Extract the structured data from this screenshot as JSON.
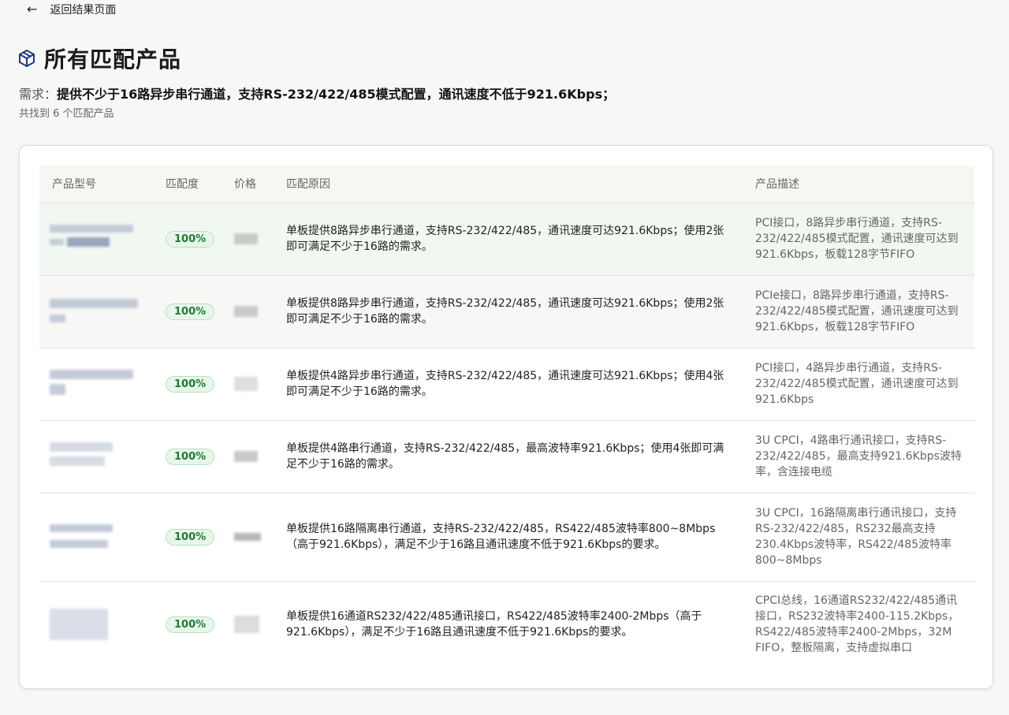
{
  "nav": {
    "back_label": "返回结果页面"
  },
  "header": {
    "title": "所有匹配产品",
    "requirement_prefix": "需求：",
    "requirement_text": "提供不少于16路异步串行通道，支持RS-232/422/485模式配置，通讯速度不低于921.6Kbps；",
    "count_text": "共找到 6 个匹配产品"
  },
  "table": {
    "columns": [
      "产品型号",
      "匹配度",
      "价格",
      "匹配原因",
      "产品描述"
    ],
    "rows": [
      {
        "match": "100%",
        "reason": "单板提供8路异步串行通道，支持RS-232/422/485，通讯速度可达921.6Kbps；使用2张即可满足不少于16路的需求。",
        "description": "PCI接口，8路异步串行通道，支持RS-232/422/485模式配置，通讯速度可达到921.6Kbps，板载128字节FIFO"
      },
      {
        "match": "100%",
        "reason": "单板提供8路异步串行通道，支持RS-232/422/485，通讯速度可达921.6Kbps；使用2张即可满足不少于16路的需求。",
        "description": "PCIe接口，8路异步串行通道，支持RS-232/422/485模式配置，通讯速度可达到921.6Kbps，板载128字节FIFO"
      },
      {
        "match": "100%",
        "reason": "单板提供4路异步串行通道，支持RS-232/422/485，通讯速度可达921.6Kbps；使用4张即可满足不少于16路的需求。",
        "description": "PCI接口，4路异步串行通道，支持RS-232/422/485模式配置，通讯速度可达到921.6Kbps"
      },
      {
        "match": "100%",
        "reason": "单板提供4路串行通道，支持RS-232/422/485，最高波特率921.6Kbps；使用4张即可满足不少于16路的需求。",
        "description": "3U CPCI，4路串行通讯接口，支持RS-232/422/485，最高支持921.6Kbps波特率，含连接电缆"
      },
      {
        "match": "100%",
        "reason": "单板提供16路隔离串行通道，支持RS-232/422/485，RS422/485波特率800~8Mbps（高于921.6Kbps），满足不少于16路且通讯速度不低于921.6Kbps的要求。",
        "description": "3U CPCI，16路隔离串行通讯接口，支持RS-232/422/485，RS232最高支持230.4Kbps波特率，RS422/485波特率800~8Mbps"
      },
      {
        "match": "100%",
        "reason": "单板提供16通道RS232/422/485通讯接口，RS422/485波特率2400-2Mbps（高于921.6Kbps），满足不少于16路且通讯速度不低于921.6Kbps的要求。",
        "description": "CPCI总线，16通道RS232/422/485通讯接口，RS232波特率2400-115.2Kbps，RS422/485波特率2400-2Mbps，32M FIFO，整板隔离，支持虚拟串口"
      }
    ]
  }
}
